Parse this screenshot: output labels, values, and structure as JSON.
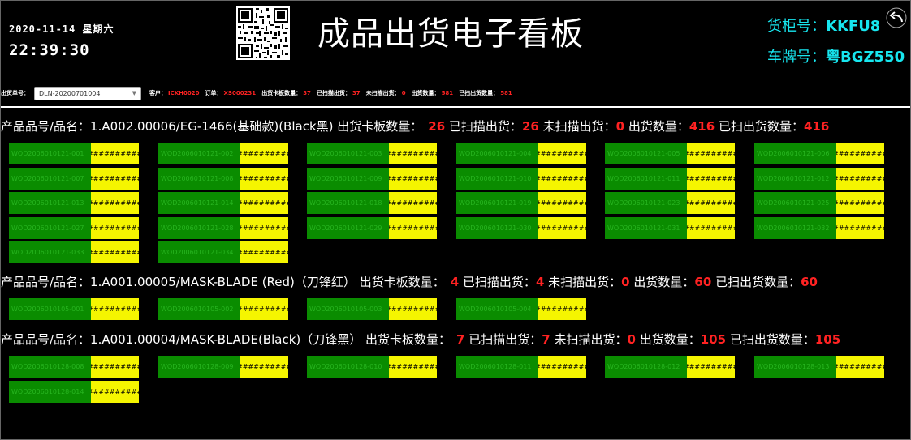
{
  "header": {
    "date_line": "2020-11-14 星期六",
    "time": "22:39:30",
    "title": "成品出货电子看板",
    "container_label": "货柜号：",
    "container_value": "KKFU8",
    "plate_label": "车牌号：",
    "plate_value": "粤BGZ550"
  },
  "filters": {
    "shipment_label": "出货单号：",
    "shipment_value": "DLN-20200701004",
    "customer_label": "客户：",
    "customer_value": "ICKH0020",
    "order_label": "订单：",
    "order_value": "XS000231",
    "pallet_label": "出货卡板数量：",
    "pallet_value": "37",
    "scanned_label": "已扫描出货：",
    "scanned_value": "37",
    "unscanned_label": "未扫描出货：",
    "unscanned_value": "0",
    "qty_label": "出货数量：",
    "qty_value": "581",
    "scanned_qty_label": "已扫出货数量：",
    "scanned_qty_value": "581"
  },
  "colors": {
    "accent": "#17e6ef",
    "highlight": "#ff2222",
    "tile_green": "#0a8c00",
    "tile_yellow": "#f5f500"
  },
  "groups": [
    {
      "product": "产品品号/品名：1.A002.00006/EG-1466(基础款)(Black黑)",
      "pallet_label": " 出货卡板数量：",
      "pallet": "26",
      "scanned_label": "已扫描出货：",
      "scanned": "26",
      "unscanned_label": "未扫描出货：",
      "unscanned": "0",
      "qty_label": "出货数量：",
      "qty": "416",
      "scanned_qty_label": "已扫出货数量：",
      "scanned_qty": "416",
      "tiles": [
        {
          "code": "WOD2006010121-001",
          "hash": "##########"
        },
        {
          "code": "WOD2006010121-002",
          "hash": "##########"
        },
        {
          "code": "WOD2006010121-003",
          "hash": "##########"
        },
        {
          "code": "WOD2006010121-004",
          "hash": "##########"
        },
        {
          "code": "WOD2006010121-005",
          "hash": "##########"
        },
        {
          "code": "WOD2006010121-006",
          "hash": "##########"
        },
        {
          "code": "WOD2006010121-007",
          "hash": "##########"
        },
        {
          "code": "WOD2006010121-008",
          "hash": "##########"
        },
        {
          "code": "WOD2006010121-009",
          "hash": "##########"
        },
        {
          "code": "WOD2006010121-010",
          "hash": "##########"
        },
        {
          "code": "WOD2006010121-011",
          "hash": "##########"
        },
        {
          "code": "WOD2006010121-012",
          "hash": "##########"
        },
        {
          "code": "WOD2006010121-013",
          "hash": "##########"
        },
        {
          "code": "WOD2006010121-014",
          "hash": "##########"
        },
        {
          "code": "WOD2006010121-018",
          "hash": "##########"
        },
        {
          "code": "WOD2006010121-019",
          "hash": "##########"
        },
        {
          "code": "WOD2006010121-023",
          "hash": "##########"
        },
        {
          "code": "WOD2006010121-025",
          "hash": "##########"
        },
        {
          "code": "WOD2006010121-027",
          "hash": "##########"
        },
        {
          "code": "WOD2006010121-028",
          "hash": "##########"
        },
        {
          "code": "WOD2006010121-029",
          "hash": "##########"
        },
        {
          "code": "WOD2006010121-030",
          "hash": "##########"
        },
        {
          "code": "WOD2006010121-031",
          "hash": "##########"
        },
        {
          "code": "WOD2006010121-032",
          "hash": "##########"
        },
        {
          "code": "WOD2006010121-033",
          "hash": "##########"
        },
        {
          "code": "WOD2006010121-034",
          "hash": "##########"
        }
      ]
    },
    {
      "product": "产品品号/品名：1.A001.00005/MASK-BLADE (Red)（刀锋红）",
      "pallet_label": " 出货卡板数量：",
      "pallet": "4",
      "scanned_label": "已扫描出货：",
      "scanned": "4",
      "unscanned_label": "未扫描出货：",
      "unscanned": "0",
      "qty_label": "出货数量：",
      "qty": "60",
      "scanned_qty_label": "已扫出货数量：",
      "scanned_qty": "60",
      "tiles": [
        {
          "code": "WOD2006010105-001",
          "hash": "##########"
        },
        {
          "code": "WOD2006010105-002",
          "hash": "##########"
        },
        {
          "code": "WOD2006010105-003",
          "hash": "##########"
        },
        {
          "code": "WOD2006010105-004",
          "hash": "##########"
        }
      ]
    },
    {
      "product": "产品品号/品名：1.A001.00004/MASK-BLADE(Black)（刀锋黑）",
      "pallet_label": " 出货卡板数量：",
      "pallet": "7",
      "scanned_label": "已扫描出货：",
      "scanned": "7",
      "unscanned_label": "未扫描出货：",
      "unscanned": "0",
      "qty_label": "出货数量：",
      "qty": "105",
      "scanned_qty_label": "已扫出货数量：",
      "scanned_qty": "105",
      "tiles": [
        {
          "code": "WOD2006010128-008",
          "hash": "##########"
        },
        {
          "code": "WOD2006010128-009",
          "hash": "##########"
        },
        {
          "code": "WOD2006010128-010",
          "hash": "##########"
        },
        {
          "code": "WOD2006010128-011",
          "hash": "##########"
        },
        {
          "code": "WOD2006010128-012",
          "hash": "##########"
        },
        {
          "code": "WOD2006010128-013",
          "hash": "##########"
        },
        {
          "code": "WOD2006010128-014",
          "hash": "##########"
        }
      ]
    }
  ]
}
